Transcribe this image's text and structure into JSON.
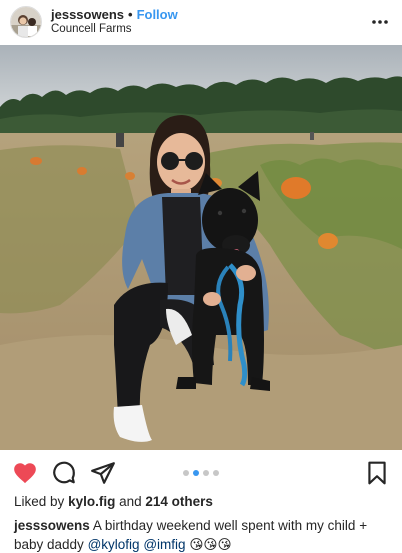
{
  "header": {
    "username": "jesssowens",
    "separator": "•",
    "follow_label": "Follow",
    "location": "Councell Farms"
  },
  "carousel": {
    "total": 4,
    "active_index": 1
  },
  "likes": {
    "prefix": "Liked by",
    "user": "kylo.fig",
    "middle": "and",
    "others": "214 others"
  },
  "caption": {
    "username": "jesssowens",
    "text": "A birthday weekend well spent with my child + baby daddy",
    "mention_1": "@kylofig",
    "mention_2": "@imfig",
    "emoji": "😘😘😘"
  },
  "icons": {
    "more": "more-options-icon",
    "like": "heart-icon",
    "comment": "comment-icon",
    "share": "share-icon",
    "save": "bookmark-icon"
  },
  "colors": {
    "accent": "#3897f0",
    "heart": "#ed4956",
    "text": "#262626"
  }
}
